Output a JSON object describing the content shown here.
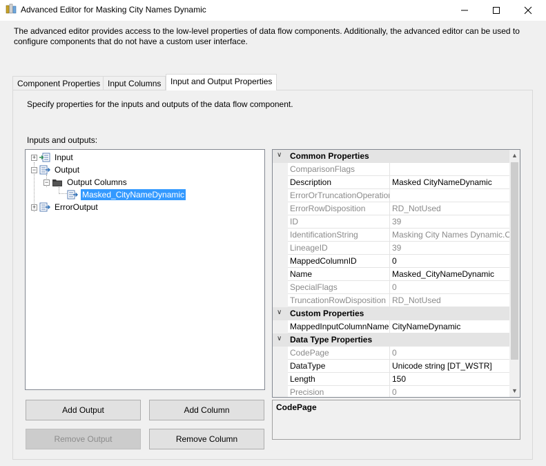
{
  "window": {
    "title": "Advanced Editor for Masking City Names Dynamic",
    "description": "The advanced editor provides access to the low-level properties of data flow components. Additionally, the advanced editor can be used to configure components that do not have a custom user interface."
  },
  "tabs": [
    {
      "label": "Component Properties",
      "active": false
    },
    {
      "label": "Input Columns",
      "active": false
    },
    {
      "label": "Input and Output Properties",
      "active": true
    }
  ],
  "panel": {
    "hint": "Specify properties for the inputs and outputs of the data flow component.",
    "io_label": "Inputs and outputs:"
  },
  "tree": {
    "items": [
      {
        "label": "Input",
        "expander": "+",
        "icon": "input-icon"
      },
      {
        "label": "Output",
        "expander": "−",
        "icon": "output-icon"
      },
      {
        "label": "Output Columns",
        "expander": "−",
        "icon": "folder-icon"
      },
      {
        "label": "Masked_CityNameDynamic",
        "expander": "",
        "icon": "column-icon",
        "selected": true
      },
      {
        "label": "ErrorOutput",
        "expander": "+",
        "icon": "output-icon"
      }
    ]
  },
  "grid": {
    "categories": [
      {
        "name": "Common Properties",
        "toggle": "∨"
      },
      {
        "name": "Custom Properties",
        "toggle": "∨"
      },
      {
        "name": "Data Type Properties",
        "toggle": "∨"
      }
    ],
    "common": [
      {
        "name": "ComparisonFlags",
        "value": "",
        "readonly": true
      },
      {
        "name": "Description",
        "value": "Masked CityNameDynamic",
        "readonly": false
      },
      {
        "name": "ErrorOrTruncationOperation",
        "value": "",
        "readonly": true
      },
      {
        "name": "ErrorRowDisposition",
        "value": "RD_NotUsed",
        "readonly": true
      },
      {
        "name": "ID",
        "value": "39",
        "readonly": true
      },
      {
        "name": "IdentificationString",
        "value": "Masking City Names Dynamic.O",
        "readonly": true
      },
      {
        "name": "LineageID",
        "value": "39",
        "readonly": true
      },
      {
        "name": "MappedColumnID",
        "value": "0",
        "readonly": false
      },
      {
        "name": "Name",
        "value": "Masked_CityNameDynamic",
        "readonly": false
      },
      {
        "name": "SpecialFlags",
        "value": "0",
        "readonly": true
      },
      {
        "name": "TruncationRowDisposition",
        "value": "RD_NotUsed",
        "readonly": true
      }
    ],
    "custom": [
      {
        "name": "MappedInputColumnName",
        "value": "CityNameDynamic",
        "readonly": false
      }
    ],
    "datatype": [
      {
        "name": "CodePage",
        "value": "0",
        "readonly": true
      },
      {
        "name": "DataType",
        "value": "Unicode string [DT_WSTR]",
        "readonly": false
      },
      {
        "name": "Length",
        "value": "150",
        "readonly": false
      },
      {
        "name": "Precision",
        "value": "0",
        "readonly": true
      }
    ]
  },
  "description_box": {
    "title": "CodePage"
  },
  "buttons": {
    "add_output": "Add Output",
    "add_column": "Add Column",
    "remove_output": "Remove Output",
    "remove_column": "Remove Column"
  },
  "colors": {
    "selection": "#3399ff",
    "readonly_text": "#8a8a8a"
  }
}
